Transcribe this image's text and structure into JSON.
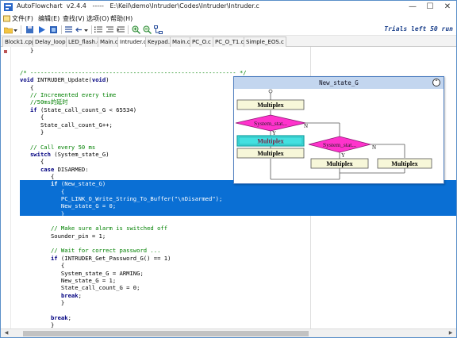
{
  "window": {
    "title": "AutoFlowchart  v2.4.4   -----   E:\\Keil\\demo\\Intruder\\Codes\\Intruder\\Intruder.c",
    "minimize": "—",
    "maximize": "☐",
    "close": "✕"
  },
  "menu": [
    {
      "label": "文件(F)"
    },
    {
      "label": "编辑(E)"
    },
    {
      "label": "查找(V)"
    },
    {
      "label": "选项(O)"
    },
    {
      "label": "帮助(H)"
    }
  ],
  "toolbar": {
    "trial_text": "Trials left 50 run"
  },
  "tabs": [
    {
      "label": "Block1.cpp"
    },
    {
      "label": "Delay_loop.c"
    },
    {
      "label": "LED_flash.c"
    },
    {
      "label": "Main.c"
    },
    {
      "label": "Intruder.c"
    },
    {
      "label": "Keypad.c"
    },
    {
      "label": "Main.c"
    },
    {
      "label": "PC_O.c"
    },
    {
      "label": "PC_O_T1.c"
    },
    {
      "label": "Simple_EOS.c"
    }
  ],
  "active_tab": 4,
  "code": [
    {
      "t": "   }",
      "c": "n"
    },
    {
      "t": "",
      "c": "n"
    },
    {
      "t": "",
      "c": "n"
    },
    {
      "t": "/* ------------------------------------------------------------ */",
      "c": "cm"
    },
    {
      "t": "void INTRUDER_Update(void)",
      "c": "n"
    },
    {
      "t": "   {",
      "c": "n"
    },
    {
      "t": "   // Incremented every time",
      "c": "cm"
    },
    {
      "t": "   //50ms的延时",
      "c": "cm"
    },
    {
      "t": "   if (State_call_count_G < 65534)",
      "c": "n"
    },
    {
      "t": "      {",
      "c": "n"
    },
    {
      "t": "      State_call_count_G++;",
      "c": "n"
    },
    {
      "t": "      }",
      "c": "n"
    },
    {
      "t": "",
      "c": "n"
    },
    {
      "t": "   // Call every 50 ms",
      "c": "cm"
    },
    {
      "t": "   switch (System_state_G)",
      "c": "n"
    },
    {
      "t": "      {",
      "c": "n"
    },
    {
      "t": "      case DISARMED:",
      "c": "n"
    },
    {
      "t": "         {",
      "c": "n"
    },
    {
      "t": "         if (New_state_G)",
      "c": "sel"
    },
    {
      "t": "            {",
      "c": "sel"
    },
    {
      "t": "            PC_LINK_O_Write_String_To_Buffer(\"\\nDisarmed\");",
      "c": "sel"
    },
    {
      "t": "            New_state_G = 0;",
      "c": "sel"
    },
    {
      "t": "            }",
      "c": "sel"
    },
    {
      "t": "",
      "c": "n"
    },
    {
      "t": "         // Make sure alarm is switched off",
      "c": "cm"
    },
    {
      "t": "         Sounder_pin = 1;",
      "c": "n"
    },
    {
      "t": "",
      "c": "n"
    },
    {
      "t": "         // Wait for correct password ...",
      "c": "cm"
    },
    {
      "t": "         if (INTRUDER_Get_Password_G() == 1)",
      "c": "n"
    },
    {
      "t": "            {",
      "c": "n"
    },
    {
      "t": "            System_state_G = ARMING;",
      "c": "n"
    },
    {
      "t": "            New_state_G = 1;",
      "c": "n"
    },
    {
      "t": "            State_call_count_G = 0;",
      "c": "n"
    },
    {
      "t": "            break;",
      "c": "n"
    },
    {
      "t": "            }",
      "c": "n"
    },
    {
      "t": "",
      "c": "n"
    },
    {
      "t": "         break;",
      "c": "n"
    },
    {
      "t": "         }",
      "c": "n"
    },
    {
      "t": "",
      "c": "n"
    }
  ],
  "flowchart": {
    "title": "New_state_G",
    "collapse_icon": "⌃",
    "box1": "Multiplex",
    "diamond1": "System_stat...",
    "box2_highlight": "Multiplex",
    "box3": "Multiplex",
    "diamond2": "System_stat...",
    "box4": "Multiplex",
    "box5": "Multiplex",
    "n_label_1": "N",
    "n_label_2": "N",
    "y_label_1": "Y",
    "y_label_2": "Y"
  },
  "colors": {
    "selection": "#0a6fd4",
    "comment": "#008000",
    "diamond_fill": "#ff33cc",
    "highlight_box": "#44e0e0",
    "box_fill": "#f7f7d9",
    "flowchart_title_bg": "#c3d6ef"
  }
}
